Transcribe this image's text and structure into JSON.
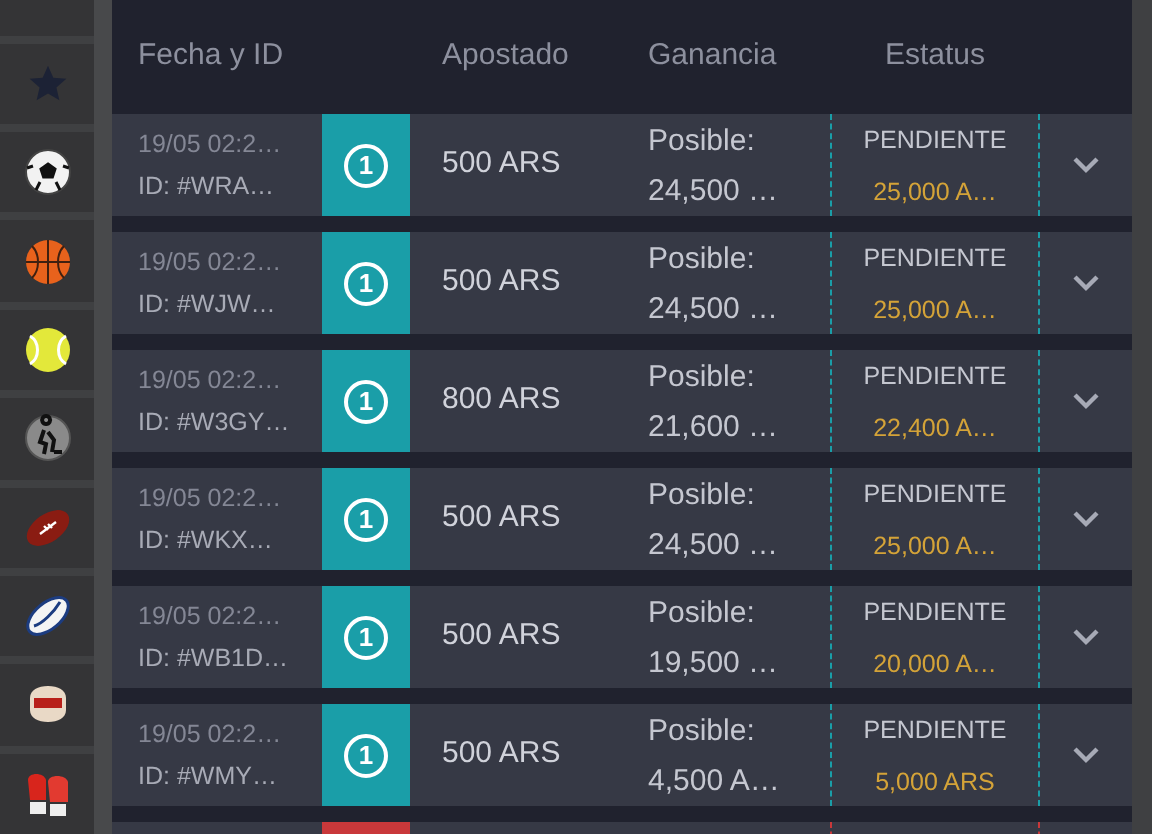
{
  "table": {
    "columns": [
      "Fecha y ID",
      "Apostado",
      "Ganancia",
      "Estatus"
    ],
    "rows": [
      {
        "date": "19/05 02:2…",
        "id": "ID: #WRA…",
        "marker": "1",
        "color": "#1a9ea8",
        "stake": "500 ARS",
        "gain_label": "Posible:",
        "gain": "24,500 …",
        "status": "PENDIENTE",
        "payout": "25,000 A…"
      },
      {
        "date": "19/05 02:2…",
        "id": "ID: #WJW…",
        "marker": "1",
        "color": "#1a9ea8",
        "stake": "500 ARS",
        "gain_label": "Posible:",
        "gain": "24,500 …",
        "status": "PENDIENTE",
        "payout": "25,000 A…"
      },
      {
        "date": "19/05 02:2…",
        "id": "ID: #W3GY…",
        "marker": "1",
        "color": "#1a9ea8",
        "stake": "800 ARS",
        "gain_label": "Posible:",
        "gain": "21,600 …",
        "status": "PENDIENTE",
        "payout": "22,400 A…"
      },
      {
        "date": "19/05 02:2…",
        "id": "ID: #WKX…",
        "marker": "1",
        "color": "#1a9ea8",
        "stake": "500 ARS",
        "gain_label": "Posible:",
        "gain": "24,500 …",
        "status": "PENDIENTE",
        "payout": "25,000 A…"
      },
      {
        "date": "19/05 02:2…",
        "id": "ID: #WB1D…",
        "marker": "1",
        "color": "#1a9ea8",
        "stake": "500 ARS",
        "gain_label": "Posible:",
        "gain": "19,500 …",
        "status": "PENDIENTE",
        "payout": "20,000 A…"
      },
      {
        "date": "19/05 02:2…",
        "id": "ID: #WMY…",
        "marker": "1",
        "color": "#1a9ea8",
        "stake": "500 ARS",
        "gain_label": "Posible:",
        "gain": "4,500 A…",
        "status": "PENDIENTE",
        "payout": "5,000 ARS"
      },
      {
        "color": "#c9383a"
      }
    ]
  }
}
